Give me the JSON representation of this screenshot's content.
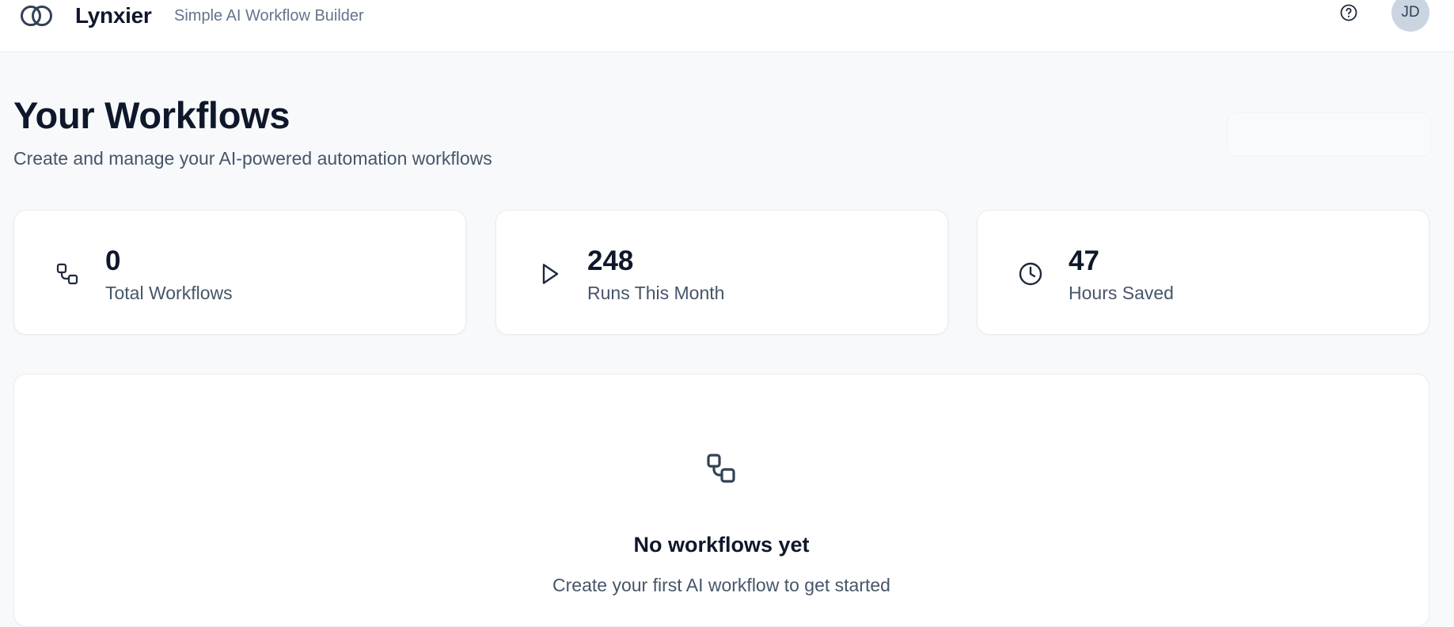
{
  "header": {
    "brand": "Lynxier",
    "tagline": "Simple AI Workflow Builder",
    "avatar_initials": "JD",
    "logo_icon": "interlocking-rings-icon",
    "help_icon": "help-circle-icon"
  },
  "page": {
    "title": "Your Workflows",
    "subtitle": "Create and manage your AI-powered automation workflows"
  },
  "stats": [
    {
      "value": "0",
      "label": "Total Workflows",
      "icon": "workflow-icon"
    },
    {
      "value": "248",
      "label": "Runs This Month",
      "icon": "play-icon"
    },
    {
      "value": "47",
      "label": "Hours Saved",
      "icon": "clock-icon"
    }
  ],
  "empty_state": {
    "icon": "workflow-icon",
    "title": "No workflows yet",
    "text": "Create your first AI workflow to get started"
  },
  "colors": {
    "text_primary": "#0f172a",
    "text_secondary": "#475569",
    "background": "#f7f9fb",
    "card": "#ffffff",
    "avatar_bg": "#cbd5e1"
  }
}
